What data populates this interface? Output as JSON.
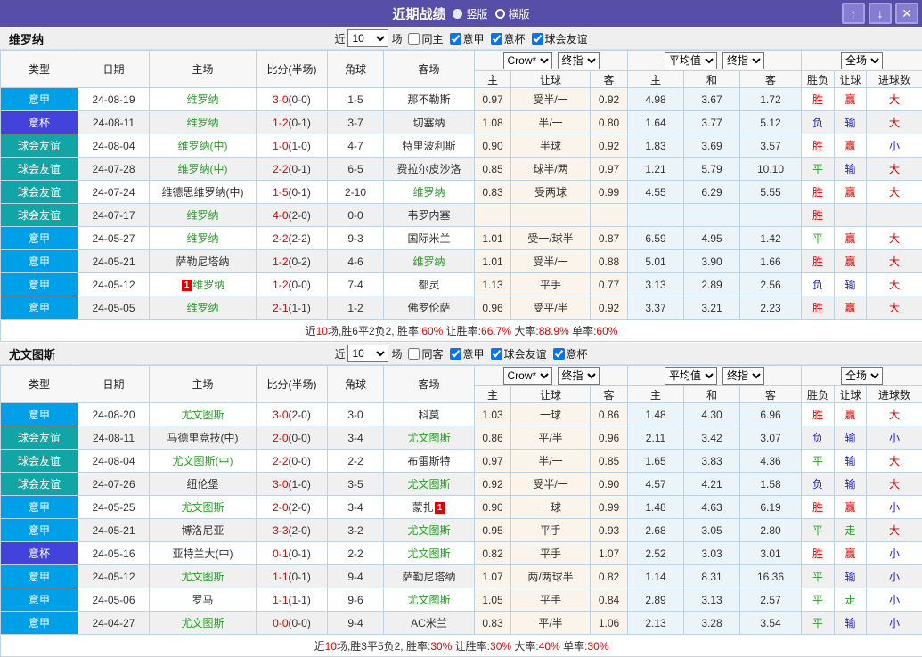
{
  "title_bar": {
    "title": "近期战绩",
    "vertical_label": "竖版",
    "horizontal_label": "横版",
    "up_glyph": "↑",
    "down_glyph": "↓",
    "close_glyph": "✕"
  },
  "labels": {
    "near": "近",
    "matches": "场"
  },
  "headers": {
    "type": "类型",
    "date": "日期",
    "home": "主场",
    "score": "比分(半场)",
    "corner": "角球",
    "away": "客场",
    "dd_crow": "Crow*",
    "dd_final_a": "终指",
    "dd_avg": "平均值",
    "dd_final_b": "终指",
    "dd_scope": "全场",
    "sub_home": "主",
    "sub_handicap": "让球",
    "sub_away": "客",
    "sub_h": "主",
    "sub_d": "和",
    "sub_a": "客",
    "sub_result": "胜负",
    "sub_asian": "让球",
    "sub_goals": "进球数"
  },
  "colors": {
    "titlebar": "#574EA8",
    "seriea": "#00A0E9",
    "coppa": "#4343DB",
    "friendly": "#12A5A5",
    "red": "#E00000",
    "blue": "#2222CC",
    "green": "#2E9B2E",
    "handicap-bg": "#FAF4EA",
    "europe-bg": "#EBF5F9",
    "grid": "#BDD3E4"
  },
  "sections": [
    {
      "team": "维罗纳",
      "controls": {
        "count": "10",
        "same": "同主",
        "filters": [
          "意甲",
          "意杯",
          "球会友谊"
        ]
      },
      "rows": [
        {
          "league": "意甲",
          "lc": "a",
          "date": "24-08-19",
          "home": {
            "name": "维罗纳",
            "green": true
          },
          "ft": "3-0",
          "ht": "(0-0)",
          "corner": "1-5",
          "away": {
            "name": "那不勒斯",
            "green": false
          },
          "o": [
            "0.97",
            "受半/一",
            "0.92"
          ],
          "e": [
            "4.98",
            "3.67",
            "1.72"
          ],
          "res": [
            [
              "胜",
              "r"
            ],
            [
              "赢",
              "r"
            ],
            [
              "大",
              "r"
            ]
          ]
        },
        {
          "league": "意杯",
          "lc": "c",
          "date": "24-08-11",
          "home": {
            "name": "维罗纳",
            "green": true
          },
          "ft": "1-2",
          "ht": "(0-1)",
          "corner": "3-7",
          "away": {
            "name": "切塞纳",
            "green": false
          },
          "o": [
            "1.08",
            "半/一",
            "0.80"
          ],
          "e": [
            "1.64",
            "3.77",
            "5.12"
          ],
          "res": [
            [
              "负",
              "b"
            ],
            [
              "输",
              "b"
            ],
            [
              "大",
              "r"
            ]
          ]
        },
        {
          "league": "球会友谊",
          "lc": "f",
          "date": "24-08-04",
          "home": {
            "name": "维罗纳(中)",
            "green": true
          },
          "ft": "1-0",
          "ht": "(1-0)",
          "corner": "4-7",
          "away": {
            "name": "特里波利斯",
            "green": false
          },
          "o": [
            "0.90",
            "半球",
            "0.92"
          ],
          "e": [
            "1.83",
            "3.69",
            "3.57"
          ],
          "res": [
            [
              "胜",
              "r"
            ],
            [
              "赢",
              "r"
            ],
            [
              "小",
              "b"
            ]
          ]
        },
        {
          "league": "球会友谊",
          "lc": "f",
          "date": "24-07-28",
          "home": {
            "name": "维罗纳(中)",
            "green": true
          },
          "ft": "2-2",
          "ht": "(0-1)",
          "corner": "6-5",
          "away": {
            "name": "费拉尔皮沙洛",
            "green": false
          },
          "o": [
            "0.85",
            "球半/两",
            "0.97"
          ],
          "e": [
            "1.21",
            "5.79",
            "10.10"
          ],
          "res": [
            [
              "平",
              "g"
            ],
            [
              "输",
              "b"
            ],
            [
              "大",
              "r"
            ]
          ]
        },
        {
          "league": "球会友谊",
          "lc": "f",
          "date": "24-07-24",
          "home": {
            "name": "维德思维罗纳(中)",
            "green": false
          },
          "ft": "1-5",
          "ht": "(0-1)",
          "corner": "2-10",
          "away": {
            "name": "维罗纳",
            "green": true
          },
          "o": [
            "0.83",
            "受两球",
            "0.99"
          ],
          "e": [
            "4.55",
            "6.29",
            "5.55"
          ],
          "res": [
            [
              "胜",
              "r"
            ],
            [
              "赢",
              "r"
            ],
            [
              "大",
              "r"
            ]
          ]
        },
        {
          "league": "球会友谊",
          "lc": "f",
          "date": "24-07-17",
          "home": {
            "name": "维罗纳",
            "green": true
          },
          "ft": "4-0",
          "ht": "(2-0)",
          "corner": "0-0",
          "away": {
            "name": "韦罗内塞",
            "green": false
          },
          "o": [
            "",
            "",
            ""
          ],
          "e": [
            "",
            "",
            ""
          ],
          "res": [
            [
              "胜",
              "r"
            ],
            [
              "",
              "k"
            ],
            [
              "",
              "k"
            ]
          ]
        },
        {
          "league": "意甲",
          "lc": "a",
          "date": "24-05-27",
          "home": {
            "name": "维罗纳",
            "green": true
          },
          "ft": "2-2",
          "ht": "(2-2)",
          "corner": "9-3",
          "away": {
            "name": "国际米兰",
            "green": false
          },
          "o": [
            "1.01",
            "受一/球半",
            "0.87"
          ],
          "e": [
            "6.59",
            "4.95",
            "1.42"
          ],
          "res": [
            [
              "平",
              "g"
            ],
            [
              "赢",
              "r"
            ],
            [
              "大",
              "r"
            ]
          ]
        },
        {
          "league": "意甲",
          "lc": "a",
          "date": "24-05-21",
          "home": {
            "name": "萨勒尼塔纳",
            "green": false
          },
          "ft": "1-2",
          "ht": "(0-2)",
          "corner": "4-6",
          "away": {
            "name": "维罗纳",
            "green": true
          },
          "o": [
            "1.01",
            "受半/一",
            "0.88"
          ],
          "e": [
            "5.01",
            "3.90",
            "1.66"
          ],
          "res": [
            [
              "胜",
              "r"
            ],
            [
              "赢",
              "r"
            ],
            [
              "大",
              "r"
            ]
          ]
        },
        {
          "league": "意甲",
          "lc": "a",
          "date": "24-05-12",
          "home": {
            "name": "维罗纳",
            "green": true,
            "card": "1",
            "card_pos": "pre"
          },
          "ft": "1-2",
          "ht": "(0-0)",
          "corner": "7-4",
          "away": {
            "name": "都灵",
            "green": false
          },
          "o": [
            "1.13",
            "平手",
            "0.77"
          ],
          "e": [
            "3.13",
            "2.89",
            "2.56"
          ],
          "res": [
            [
              "负",
              "b"
            ],
            [
              "输",
              "b"
            ],
            [
              "大",
              "r"
            ]
          ]
        },
        {
          "league": "意甲",
          "lc": "a",
          "date": "24-05-05",
          "home": {
            "name": "维罗纳",
            "green": true
          },
          "ft": "2-1",
          "ht": "(1-1)",
          "corner": "1-2",
          "away": {
            "name": "佛罗伦萨",
            "green": false
          },
          "o": [
            "0.96",
            "受平/半",
            "0.92"
          ],
          "e": [
            "3.37",
            "3.21",
            "2.23"
          ],
          "res": [
            [
              "胜",
              "r"
            ],
            [
              "赢",
              "r"
            ],
            [
              "大",
              "r"
            ]
          ]
        }
      ],
      "summary": [
        {
          "t": "近",
          "c": "k"
        },
        {
          "t": "10",
          "c": "r"
        },
        {
          "t": "场,胜6平2负2, 胜率:",
          "c": "k"
        },
        {
          "t": "60%",
          "c": "r"
        },
        {
          "t": " 让胜率:",
          "c": "k"
        },
        {
          "t": "66.7%",
          "c": "r"
        },
        {
          "t": " 大率:",
          "c": "k"
        },
        {
          "t": "88.9%",
          "c": "r"
        },
        {
          "t": " 单率:",
          "c": "k"
        },
        {
          "t": "60%",
          "c": "r"
        }
      ]
    },
    {
      "team": "尤文图斯",
      "controls": {
        "count": "10",
        "same": "同客",
        "filters": [
          "意甲",
          "球会友谊",
          "意杯"
        ]
      },
      "rows": [
        {
          "league": "意甲",
          "lc": "a",
          "date": "24-08-20",
          "home": {
            "name": "尤文图斯",
            "green": true
          },
          "ft": "3-0",
          "ht": "(2-0)",
          "corner": "3-0",
          "away": {
            "name": "科莫",
            "green": false
          },
          "o": [
            "1.03",
            "一球",
            "0.86"
          ],
          "e": [
            "1.48",
            "4.30",
            "6.96"
          ],
          "res": [
            [
              "胜",
              "r"
            ],
            [
              "赢",
              "r"
            ],
            [
              "大",
              "r"
            ]
          ]
        },
        {
          "league": "球会友谊",
          "lc": "f",
          "date": "24-08-11",
          "home": {
            "name": "马德里竞技(中)",
            "green": false
          },
          "ft": "2-0",
          "ht": "(0-0)",
          "corner": "3-4",
          "away": {
            "name": "尤文图斯",
            "green": true
          },
          "o": [
            "0.86",
            "平/半",
            "0.96"
          ],
          "e": [
            "2.11",
            "3.42",
            "3.07"
          ],
          "res": [
            [
              "负",
              "b"
            ],
            [
              "输",
              "b"
            ],
            [
              "小",
              "b"
            ]
          ]
        },
        {
          "league": "球会友谊",
          "lc": "f",
          "date": "24-08-04",
          "home": {
            "name": "尤文图斯(中)",
            "green": true
          },
          "ft": "2-2",
          "ht": "(0-0)",
          "corner": "2-2",
          "away": {
            "name": "布雷斯特",
            "green": false
          },
          "o": [
            "0.97",
            "半/一",
            "0.85"
          ],
          "e": [
            "1.65",
            "3.83",
            "4.36"
          ],
          "res": [
            [
              "平",
              "g"
            ],
            [
              "输",
              "b"
            ],
            [
              "大",
              "r"
            ]
          ]
        },
        {
          "league": "球会友谊",
          "lc": "f",
          "date": "24-07-26",
          "home": {
            "name": "纽伦堡",
            "green": false
          },
          "ft": "3-0",
          "ht": "(1-0)",
          "corner": "3-5",
          "away": {
            "name": "尤文图斯",
            "green": true
          },
          "o": [
            "0.92",
            "受半/一",
            "0.90"
          ],
          "e": [
            "4.57",
            "4.21",
            "1.58"
          ],
          "res": [
            [
              "负",
              "b"
            ],
            [
              "输",
              "b"
            ],
            [
              "大",
              "r"
            ]
          ]
        },
        {
          "league": "意甲",
          "lc": "a",
          "date": "24-05-25",
          "home": {
            "name": "尤文图斯",
            "green": true
          },
          "ft": "2-0",
          "ht": "(2-0)",
          "corner": "3-4",
          "away": {
            "name": "蒙扎",
            "green": false,
            "card": "1",
            "card_pos": "post"
          },
          "o": [
            "0.90",
            "一球",
            "0.99"
          ],
          "e": [
            "1.48",
            "4.63",
            "6.19"
          ],
          "res": [
            [
              "胜",
              "r"
            ],
            [
              "赢",
              "r"
            ],
            [
              "小",
              "b"
            ]
          ]
        },
        {
          "league": "意甲",
          "lc": "a",
          "date": "24-05-21",
          "home": {
            "name": "博洛尼亚",
            "green": false
          },
          "ft": "3-3",
          "ht": "(2-0)",
          "corner": "3-2",
          "away": {
            "name": "尤文图斯",
            "green": true
          },
          "o": [
            "0.95",
            "平手",
            "0.93"
          ],
          "e": [
            "2.68",
            "3.05",
            "2.80"
          ],
          "res": [
            [
              "平",
              "g"
            ],
            [
              "走",
              "g"
            ],
            [
              "大",
              "r"
            ]
          ]
        },
        {
          "league": "意杯",
          "lc": "c",
          "date": "24-05-16",
          "home": {
            "name": "亚特兰大(中)",
            "green": false
          },
          "ft": "0-1",
          "ht": "(0-1)",
          "corner": "2-2",
          "away": {
            "name": "尤文图斯",
            "green": true
          },
          "o": [
            "0.82",
            "平手",
            "1.07"
          ],
          "e": [
            "2.52",
            "3.03",
            "3.01"
          ],
          "res": [
            [
              "胜",
              "r"
            ],
            [
              "赢",
              "r"
            ],
            [
              "小",
              "b"
            ]
          ]
        },
        {
          "league": "意甲",
          "lc": "a",
          "date": "24-05-12",
          "home": {
            "name": "尤文图斯",
            "green": true
          },
          "ft": "1-1",
          "ht": "(0-1)",
          "corner": "9-4",
          "away": {
            "name": "萨勒尼塔纳",
            "green": false
          },
          "o": [
            "1.07",
            "两/两球半",
            "0.82"
          ],
          "e": [
            "1.14",
            "8.31",
            "16.36"
          ],
          "res": [
            [
              "平",
              "g"
            ],
            [
              "输",
              "b"
            ],
            [
              "小",
              "b"
            ]
          ]
        },
        {
          "league": "意甲",
          "lc": "a",
          "date": "24-05-06",
          "home": {
            "name": "罗马",
            "green": false
          },
          "ft": "1-1",
          "ht": "(1-1)",
          "corner": "9-6",
          "away": {
            "name": "尤文图斯",
            "green": true
          },
          "o": [
            "1.05",
            "平手",
            "0.84"
          ],
          "e": [
            "2.89",
            "3.13",
            "2.57"
          ],
          "res": [
            [
              "平",
              "g"
            ],
            [
              "走",
              "g"
            ],
            [
              "小",
              "b"
            ]
          ]
        },
        {
          "league": "意甲",
          "lc": "a",
          "date": "24-04-27",
          "home": {
            "name": "尤文图斯",
            "green": true
          },
          "ft": "0-0",
          "ht": "(0-0)",
          "corner": "9-4",
          "away": {
            "name": "AC米兰",
            "green": false
          },
          "o": [
            "0.83",
            "平/半",
            "1.06"
          ],
          "e": [
            "2.13",
            "3.28",
            "3.54"
          ],
          "res": [
            [
              "平",
              "g"
            ],
            [
              "输",
              "b"
            ],
            [
              "小",
              "b"
            ]
          ]
        }
      ],
      "summary": [
        {
          "t": "近",
          "c": "k"
        },
        {
          "t": "10",
          "c": "r"
        },
        {
          "t": "场,胜3平5负2, 胜率:",
          "c": "k"
        },
        {
          "t": "30%",
          "c": "r"
        },
        {
          "t": " 让胜率:",
          "c": "k"
        },
        {
          "t": "30%",
          "c": "r"
        },
        {
          "t": " 大率:",
          "c": "k"
        },
        {
          "t": "40%",
          "c": "r"
        },
        {
          "t": " 单率:",
          "c": "k"
        },
        {
          "t": "30%",
          "c": "r"
        }
      ]
    }
  ]
}
